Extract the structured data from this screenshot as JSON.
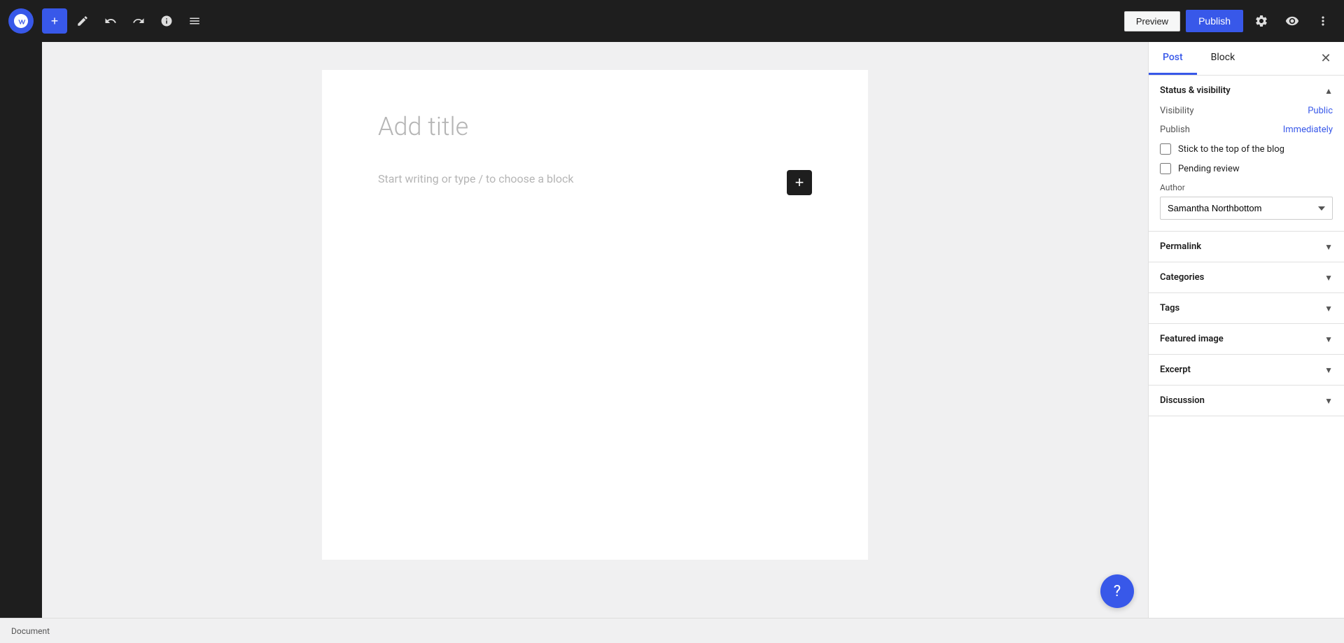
{
  "toolbar": {
    "wp_logo_alt": "WordPress",
    "add_label": "+",
    "undo_label": "↩",
    "redo_label": "↪",
    "info_label": "ℹ",
    "tools_label": "≡",
    "preview_label": "Preview",
    "publish_label": "Publish",
    "settings_icon": "⚙",
    "editor_icon": "👁",
    "more_icon": "⋮"
  },
  "editor": {
    "title_placeholder": "Add title",
    "body_placeholder": "Start writing or type / to choose a block"
  },
  "panel": {
    "tab_post": "Post",
    "tab_block": "Block",
    "sections": {
      "status_visibility": {
        "label": "Status & visibility",
        "visibility_label": "Visibility",
        "visibility_value": "Public",
        "publish_label": "Publish",
        "publish_value": "Immediately",
        "stick_label": "Stick to the top of the blog",
        "pending_label": "Pending review",
        "author_label": "Author",
        "author_value": "Samantha Northbottom"
      },
      "permalink": {
        "label": "Permalink"
      },
      "categories": {
        "label": "Categories"
      },
      "tags": {
        "label": "Tags"
      },
      "featured_image": {
        "label": "Featured image"
      },
      "excerpt": {
        "label": "Excerpt"
      },
      "discussion": {
        "label": "Discussion"
      }
    }
  },
  "status_bar": {
    "document_label": "Document"
  },
  "help_btn_label": "?"
}
